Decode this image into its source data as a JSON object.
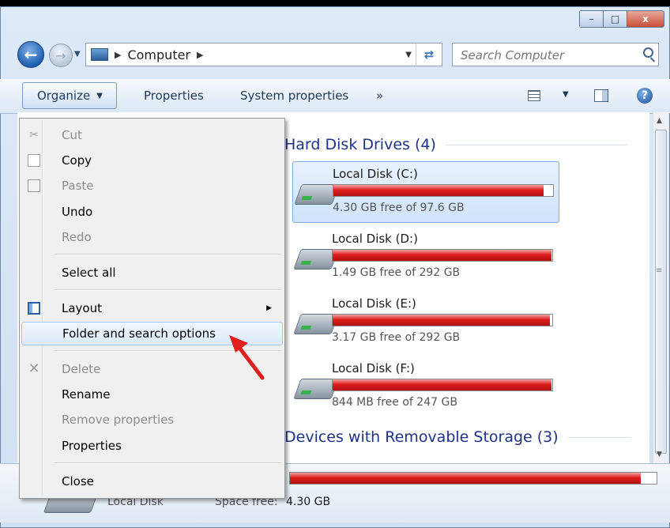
{
  "window": {
    "caption_buttons": {
      "minimize": "–",
      "maximize": "□",
      "close": "x"
    }
  },
  "nav": {
    "back_icon": "back-arrow-icon",
    "forward_icon": "forward-arrow-icon",
    "address_crumb": "Computer",
    "search_placeholder": "Search Computer"
  },
  "toolbar": {
    "organize": "Organize",
    "properties": "Properties",
    "system_properties": "System properties",
    "more": "»"
  },
  "groups": {
    "hard_disk_drives": "Hard Disk Drives (4)",
    "removable_storage": "Devices with Removable Storage (3)"
  },
  "drives": [
    {
      "name": "Local Disk (C:)",
      "free_text": "4.30 GB free of 97.6 GB",
      "used_fraction": 0.956,
      "selected": true
    },
    {
      "name": "Local Disk (D:)",
      "free_text": "1.49 GB free of 292 GB",
      "used_fraction": 0.995,
      "selected": false
    },
    {
      "name": "Local Disk (E:)",
      "free_text": "3.17 GB free of 292 GB",
      "used_fraction": 0.989,
      "selected": false
    },
    {
      "name": "Local Disk (F:)",
      "free_text": "844 MB free of 247 GB",
      "used_fraction": 0.997,
      "selected": false
    }
  ],
  "details_pane": {
    "name": "Local Disk",
    "space_free_label": "Space free:",
    "space_free_value": "4.30 GB",
    "used_fraction": 0.956
  },
  "organize_menu": {
    "cut": "Cut",
    "copy": "Copy",
    "paste": "Paste",
    "undo": "Undo",
    "redo": "Redo",
    "select_all": "Select all",
    "layout": "Layout",
    "folder_options": "Folder and search options",
    "delete": "Delete",
    "rename": "Rename",
    "remove_properties": "Remove properties",
    "properties": "Properties",
    "close": "Close"
  },
  "colors": {
    "bar_fill": "#de1e1e",
    "group_header": "#1e3287",
    "highlight": "#dce9fa",
    "annotation_arrow": "#e0201e"
  }
}
